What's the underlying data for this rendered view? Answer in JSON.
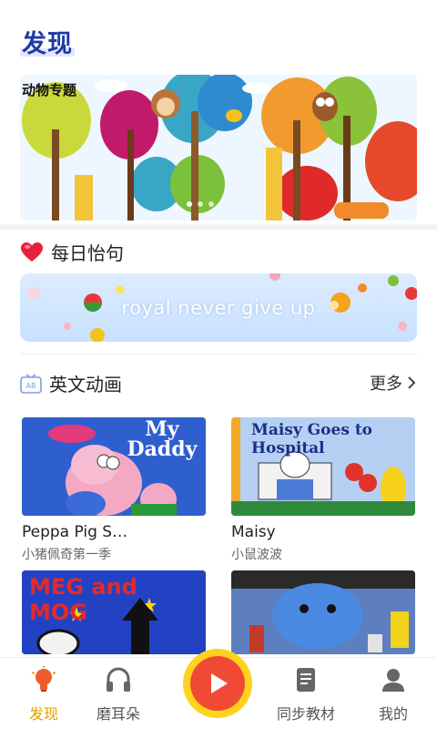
{
  "header": {
    "title": "发现"
  },
  "banner": {
    "label": "动物专题",
    "dots": 3,
    "active_dot": 0
  },
  "daily_quote": {
    "title": "每日怡句",
    "text": "royal never give up"
  },
  "animation": {
    "title": "英文动画",
    "more_label": "更多",
    "items": [
      {
        "name": "Peppa Pig S…",
        "subtitle": "小猪佩奇第一季",
        "cover_text": "My Daddy"
      },
      {
        "name": "Maisy",
        "subtitle": "小鼠波波",
        "cover_text": "Maisy Goes to Hospital"
      },
      {
        "cover_text": "MEG and MOG"
      },
      {
        "cover_text": ""
      }
    ]
  },
  "nav": {
    "items": [
      {
        "label": "发现",
        "icon": "lightbulb-icon",
        "active": true
      },
      {
        "label": "磨耳朵",
        "icon": "headphones-icon",
        "active": false
      },
      {
        "label": "",
        "icon": "play-icon",
        "active": false
      },
      {
        "label": "同步教材",
        "icon": "book-icon",
        "active": false
      },
      {
        "label": "我的",
        "icon": "person-icon",
        "active": false
      }
    ]
  },
  "colors": {
    "accent": "#e0a000",
    "title_blue": "#1f3aa8",
    "play_red": "#f04a36",
    "play_yellow": "#ffd21f"
  }
}
